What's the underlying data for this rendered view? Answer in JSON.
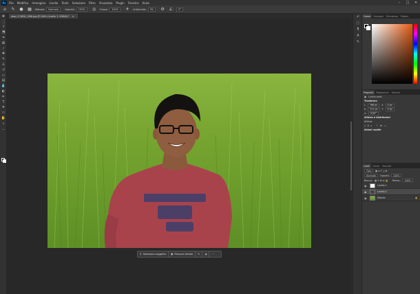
{
  "menubar": {
    "app_logo": "Ps",
    "items": [
      "File",
      "Modifica",
      "Immagine",
      "Livello",
      "Testo",
      "Selezione",
      "Filtro",
      "Visualizza",
      "Plugin",
      "Finestra",
      "Aiuto"
    ],
    "window_controls": [
      "minimize-icon",
      "maximize-icon",
      "close-icon"
    ]
  },
  "options": {
    "mode_label": "Metodo:",
    "mode_value": "Normale",
    "opacity_label": "Opacità:",
    "opacity_value": "100%",
    "flow_label": "Flusso:",
    "flow_value": "100%",
    "smoothing_label": "Uniformità:",
    "smoothing_value": "0%",
    "angle_value": "0°"
  },
  "document_tab": {
    "title": "Jeep (17)630_1280.jpg @ 100% (Livello 2, RGB/8) *",
    "close": "×"
  },
  "context_bar": {
    "select_subject": "Seleziona soggetto",
    "remove_bg": "Rimuovi sfondo",
    "more": "···"
  },
  "panels": {
    "color_tabs": [
      "Colore",
      "Campioni",
      "Sfumature",
      "Pattern"
    ],
    "props_tabs": [
      "Proprietà",
      "Regolazioni",
      "Librerie"
    ],
    "props_title": "Livello pixel",
    "transform_label": "Trasforma",
    "w_label": "L",
    "w_value": "768 px",
    "x_label": "X",
    "x_value": "0 px",
    "h_label": "A",
    "h_value": "512 px",
    "y_label": "Y",
    "y_value": "0 px",
    "angle_value": "0,00°",
    "align_label": "Allinea e distribuisci",
    "align_sub": "Allinea:",
    "quick_label": "Azioni rapide",
    "layers_tabs": [
      "Livelli",
      "Canali",
      "Tracciati"
    ],
    "search_label": "Tipo",
    "blend_value": "Normale",
    "opacity_label": "Opacità:",
    "opacity_value": "100%",
    "lock_label": "Blocca:",
    "fill_label": "Riemp.:",
    "fill_value": "100%",
    "layers": [
      {
        "name": "Livello 1",
        "selected": false
      },
      {
        "name": "Livello 2",
        "selected": true
      },
      {
        "name": "Sfondo",
        "selected": false
      }
    ]
  },
  "colors": {
    "accent": "#31a8ff",
    "fg": "#000000",
    "bg": "#ffffff",
    "picker_hue": "#e35a12"
  }
}
